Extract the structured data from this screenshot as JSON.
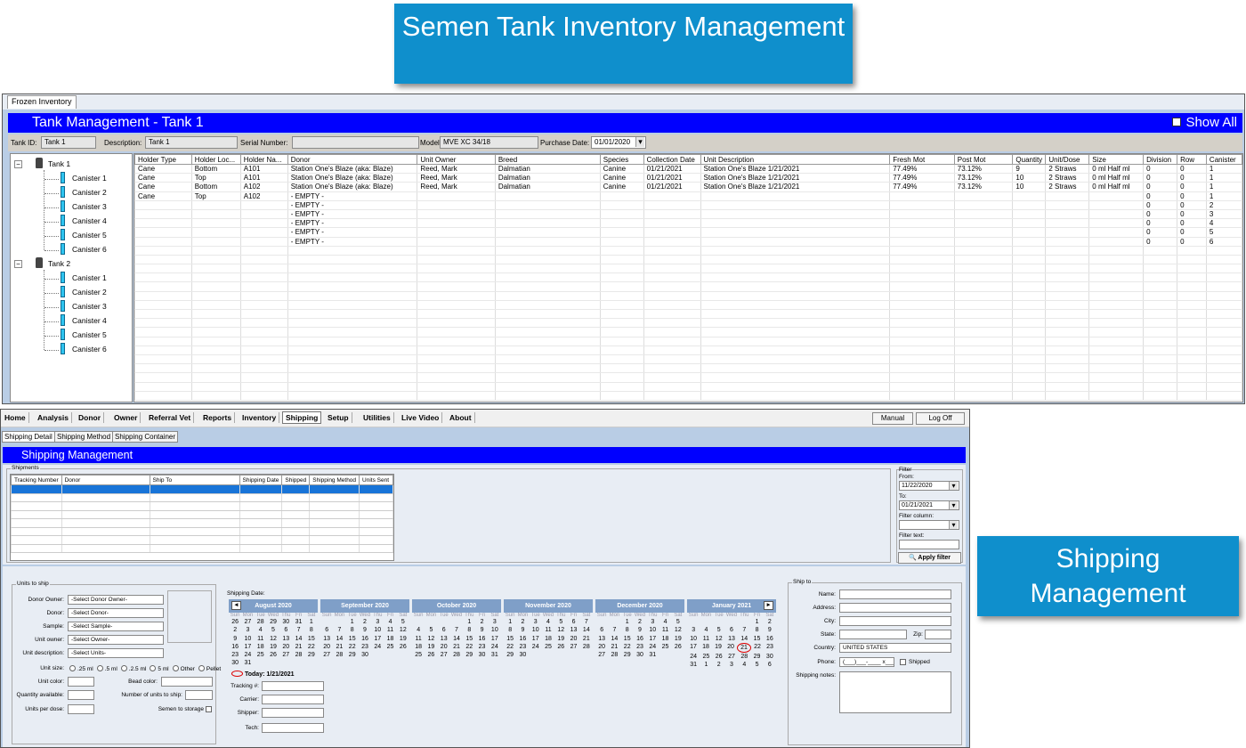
{
  "banners": {
    "tank": "Semen Tank Inventory Management",
    "shipping": "Shipping Management"
  },
  "tank_window": {
    "tab": "Frozen Inventory",
    "title": "Tank Management - Tank 1",
    "show_all": "Show All",
    "info": {
      "tank_id_label": "Tank ID:",
      "tank_id": "Tank 1",
      "description_label": "Description:",
      "description": "Tank 1",
      "serial_label": "Serial Number:",
      "serial": "",
      "model_label": "Model:",
      "model": "MVE XC 34/18",
      "purchase_label": "Purchase Date:",
      "purchase": "01/01/2020"
    },
    "tree": [
      {
        "label": "Tank 1",
        "children": [
          "Canister 1",
          "Canister 2",
          "Canister 3",
          "Canister 4",
          "Canister 5",
          "Canister 6"
        ]
      },
      {
        "label": "Tank 2",
        "children": [
          "Canister 1",
          "Canister 2",
          "Canister 3",
          "Canister 4",
          "Canister 5",
          "Canister 6"
        ]
      }
    ],
    "columns": [
      "Holder Type",
      "Holder Loc...",
      "Holder Na...",
      "Donor",
      "Unit Owner",
      "Breed",
      "Species",
      "Collection Date",
      "Unit Description",
      "Fresh Mot",
      "Post Mot",
      "Quantity",
      "Unit/Dose",
      "Size",
      "Division",
      "Row",
      "Canister"
    ],
    "rows": [
      [
        "Cane",
        "Bottom",
        "A101",
        "Station One's Blaze (aka: Blaze)",
        "Reed, Mark",
        "Dalmatian",
        "Canine",
        "01/21/2021",
        "Station One's Blaze 1/21/2021",
        "77.49%",
        "73.12%",
        "9",
        "2 Straws",
        "0 ml Half ml",
        "0",
        "0",
        "1"
      ],
      [
        "Cane",
        "Top",
        "A101",
        "Station One's Blaze (aka: Blaze)",
        "Reed, Mark",
        "Dalmatian",
        "Canine",
        "01/21/2021",
        "Station One's Blaze 1/21/2021",
        "77.49%",
        "73.12%",
        "10",
        "2 Straws",
        "0 ml Half ml",
        "0",
        "0",
        "1"
      ],
      [
        "Cane",
        "Bottom",
        "A102",
        "Station One's Blaze (aka: Blaze)",
        "Reed, Mark",
        "Dalmatian",
        "Canine",
        "01/21/2021",
        "Station One's Blaze 1/21/2021",
        "77.49%",
        "73.12%",
        "10",
        "2 Straws",
        "0 ml Half ml",
        "0",
        "0",
        "1"
      ],
      [
        "Cane",
        "Top",
        "A102",
        "- EMPTY -",
        "",
        "",
        "",
        "",
        "",
        "",
        "",
        "",
        "",
        "",
        "0",
        "0",
        "1"
      ],
      [
        "",
        "",
        "",
        "- EMPTY -",
        "",
        "",
        "",
        "",
        "",
        "",
        "",
        "",
        "",
        "",
        "0",
        "0",
        "2"
      ],
      [
        "",
        "",
        "",
        "- EMPTY -",
        "",
        "",
        "",
        "",
        "",
        "",
        "",
        "",
        "",
        "",
        "0",
        "0",
        "3"
      ],
      [
        "",
        "",
        "",
        "- EMPTY -",
        "",
        "",
        "",
        "",
        "",
        "",
        "",
        "",
        "",
        "",
        "0",
        "0",
        "4"
      ],
      [
        "",
        "",
        "",
        "- EMPTY -",
        "",
        "",
        "",
        "",
        "",
        "",
        "",
        "",
        "",
        "",
        "0",
        "0",
        "5"
      ],
      [
        "",
        "",
        "",
        "- EMPTY -",
        "",
        "",
        "",
        "",
        "",
        "",
        "",
        "",
        "",
        "",
        "0",
        "0",
        "6"
      ]
    ]
  },
  "shipping_window": {
    "menu": [
      "Home",
      "Analysis",
      "Donor",
      "Owner",
      "Referral Vet",
      "Reports",
      "Inventory",
      "Shipping",
      "Setup",
      "Utilities",
      "Live Video",
      "About"
    ],
    "manual": "Manual",
    "logoff": "Log Off",
    "subtabs": [
      "Shipping Detail",
      "Shipping Method",
      "Shipping Container"
    ],
    "title": "Shipping Management",
    "shipments_label": "Shipments",
    "shipment_columns": [
      "Tracking Number",
      "Donor",
      "Ship To",
      "Shipping Date",
      "Shipped",
      "Shipping Method",
      "Units Sent"
    ],
    "filter": {
      "label": "Filter",
      "from_label": "From:",
      "from": "11/22/2020",
      "to_label": "To:",
      "to": "01/21/2021",
      "column_label": "Filter column:",
      "text_label": "Filter text:",
      "apply": "Apply filter"
    },
    "units": {
      "label": "Units to ship",
      "donor_owner_label": "Donor Owner:",
      "donor_owner": "-Select Donor Owner-",
      "donor_label": "Donor:",
      "donor": "-Select Donor-",
      "sample_label": "Sample:",
      "sample": "-Select Sample-",
      "unit_owner_label": "Unit owner:",
      "unit_owner": "-Select Owner-",
      "unit_desc_label": "Unit description:",
      "unit_desc": "-Select Units-",
      "unit_size_label": "Unit size:",
      "sizes": [
        ".25 ml",
        ".5 ml",
        ".2.5 ml",
        "5 ml",
        "Other",
        "Pellet"
      ],
      "unit_color_label": "Unit color:",
      "bead_color_label": "Bead color:",
      "qty_avail_label": "Quantity available:",
      "num_units_label": "Number of units to ship:",
      "units_per_dose_label": "Units per dose:",
      "semen_storage_label": "Semen to storage"
    },
    "shipping_date_label": "Shipping Date:",
    "calendars": [
      {
        "month": "August 2020",
        "weeks": [
          [
            "26",
            "27",
            "28",
            "29",
            "30",
            "31",
            "1"
          ],
          [
            "2",
            "3",
            "4",
            "5",
            "6",
            "7",
            "8"
          ],
          [
            "9",
            "10",
            "11",
            "12",
            "13",
            "14",
            "15"
          ],
          [
            "16",
            "17",
            "18",
            "19",
            "20",
            "21",
            "22"
          ],
          [
            "23",
            "24",
            "25",
            "26",
            "27",
            "28",
            "29"
          ],
          [
            "30",
            "31",
            "",
            "",
            "",
            "",
            ""
          ]
        ]
      },
      {
        "month": "September 2020",
        "weeks": [
          [
            "",
            "",
            "1",
            "2",
            "3",
            "4",
            "5"
          ],
          [
            "6",
            "7",
            "8",
            "9",
            "10",
            "11",
            "12"
          ],
          [
            "13",
            "14",
            "15",
            "16",
            "17",
            "18",
            "19"
          ],
          [
            "20",
            "21",
            "22",
            "23",
            "24",
            "25",
            "26"
          ],
          [
            "27",
            "28",
            "29",
            "30",
            "",
            "",
            ""
          ]
        ]
      },
      {
        "month": "October 2020",
        "weeks": [
          [
            "",
            "",
            "",
            "",
            "1",
            "2",
            "3"
          ],
          [
            "4",
            "5",
            "6",
            "7",
            "8",
            "9",
            "10"
          ],
          [
            "11",
            "12",
            "13",
            "14",
            "15",
            "16",
            "17"
          ],
          [
            "18",
            "19",
            "20",
            "21",
            "22",
            "23",
            "24"
          ],
          [
            "25",
            "26",
            "27",
            "28",
            "29",
            "30",
            "31"
          ]
        ]
      },
      {
        "month": "November 2020",
        "weeks": [
          [
            "1",
            "2",
            "3",
            "4",
            "5",
            "6",
            "7"
          ],
          [
            "8",
            "9",
            "10",
            "11",
            "12",
            "13",
            "14"
          ],
          [
            "15",
            "16",
            "17",
            "18",
            "19",
            "20",
            "21"
          ],
          [
            "22",
            "23",
            "24",
            "25",
            "26",
            "27",
            "28"
          ],
          [
            "29",
            "30",
            "",
            "",
            "",
            "",
            ""
          ]
        ]
      },
      {
        "month": "December 2020",
        "weeks": [
          [
            "",
            "",
            "1",
            "2",
            "3",
            "4",
            "5"
          ],
          [
            "6",
            "7",
            "8",
            "9",
            "10",
            "11",
            "12"
          ],
          [
            "13",
            "14",
            "15",
            "16",
            "17",
            "18",
            "19"
          ],
          [
            "20",
            "21",
            "22",
            "23",
            "24",
            "25",
            "26"
          ],
          [
            "27",
            "28",
            "29",
            "30",
            "31",
            "",
            ""
          ]
        ]
      },
      {
        "month": "January 2021",
        "weeks": [
          [
            "",
            "",
            "",
            "",
            "",
            "1",
            "2"
          ],
          [
            "3",
            "4",
            "5",
            "6",
            "7",
            "8",
            "9"
          ],
          [
            "10",
            "11",
            "12",
            "13",
            "14",
            "15",
            "16"
          ],
          [
            "17",
            "18",
            "19",
            "20",
            "21",
            "22",
            "23"
          ],
          [
            "24",
            "25",
            "26",
            "27",
            "28",
            "29",
            "30"
          ],
          [
            "31",
            "1",
            "2",
            "3",
            "4",
            "5",
            "6"
          ]
        ]
      }
    ],
    "dow": [
      "Sun",
      "Mon",
      "Tue",
      "Wed",
      "Thu",
      "Fri",
      "Sat"
    ],
    "today": "Today: 1/21/2021",
    "tracking_label": "Tracking #:",
    "carrier_label": "Carrier:",
    "shipper_label": "Shipper:",
    "tech_label": "Tech:",
    "shipto": {
      "label": "Ship to",
      "name_label": "Name:",
      "address_label": "Address:",
      "city_label": "City:",
      "state_label": "State:",
      "zip_label": "Zip:",
      "country_label": "Country:",
      "country": "UNITED STATES",
      "phone_label": "Phone:",
      "phone": "(___)___-____ x____",
      "shipped_label": "Shipped",
      "notes_label": "Shipping notes:"
    }
  }
}
